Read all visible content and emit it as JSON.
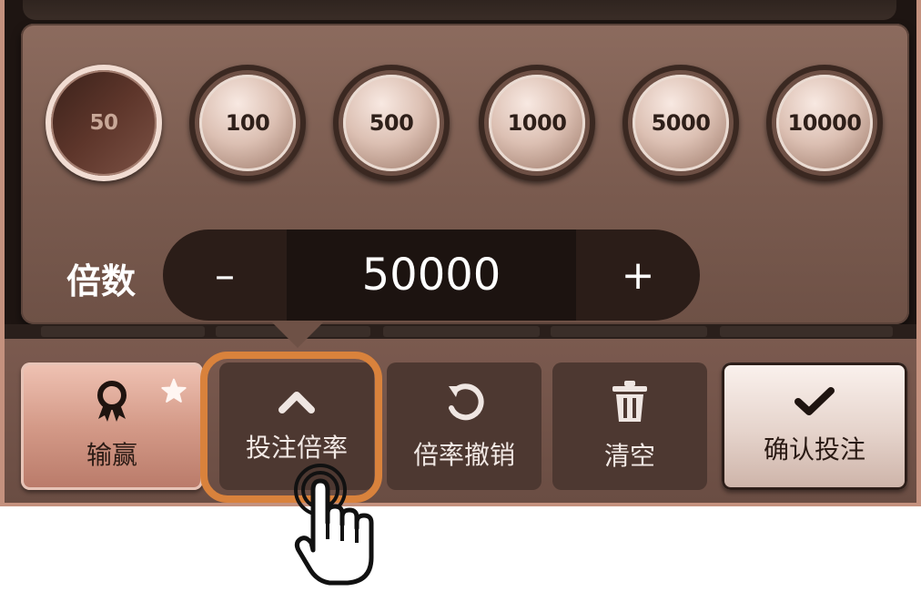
{
  "chips": [
    {
      "label": "50",
      "selected": true
    },
    {
      "label": "100",
      "selected": false
    },
    {
      "label": "500",
      "selected": false
    },
    {
      "label": "1000",
      "selected": false
    },
    {
      "label": "5000",
      "selected": false
    },
    {
      "label": "10000",
      "selected": false
    }
  ],
  "multiplier": {
    "label": "倍数",
    "minus": "–",
    "value": "50000",
    "plus": "+"
  },
  "toolbar": {
    "win_lose": "输赢",
    "bet_multiplier": "投注倍率",
    "undo_multiplier": "倍率撤销",
    "clear": "清空",
    "confirm_bet": "确认投注"
  },
  "colors": {
    "highlight": "#d9823c",
    "frame": "#c4917e",
    "panel": "#7a5b4f"
  },
  "icons": [
    "rosette-icon",
    "star-icon",
    "chevron-up-icon",
    "undo-icon",
    "trash-icon",
    "checkmark-icon",
    "tap-hand-icon"
  ]
}
